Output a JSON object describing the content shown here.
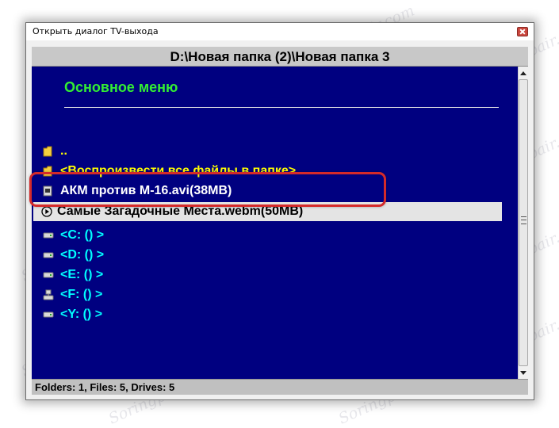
{
  "window": {
    "title": "Открыть диалог TV-выхода"
  },
  "path_bar": {
    "text": "D:\\Новая папка (2)\\Новая папка 3"
  },
  "menu": {
    "main_menu_label": "Основное меню"
  },
  "items": [
    {
      "label": "..",
      "icon": "folder-icon",
      "color": "#ffff00"
    },
    {
      "label": "<Воспроизвести все файлы в папке>",
      "icon": "folder-icon",
      "color": "#ffff00"
    },
    {
      "label": "АКМ против М-16.avi(38MB)",
      "icon": "video-file-icon",
      "color": "#ffffff"
    },
    {
      "label": "Самые Загадочные Места.webm(50MB)",
      "icon": "play-icon",
      "color": "#000000",
      "selected": true
    },
    {
      "label": "<C: () >",
      "icon": "drive-icon",
      "color": "#00ffff"
    },
    {
      "label": "<D: () >",
      "icon": "drive-icon",
      "color": "#00ffff"
    },
    {
      "label": "<E: () >",
      "icon": "drive-icon",
      "color": "#00ffff"
    },
    {
      "label": "<F: () >",
      "icon": "network-drive-icon",
      "color": "#00ffff"
    },
    {
      "label": "<Y: () >",
      "icon": "drive-icon",
      "color": "#00ffff"
    }
  ],
  "status": {
    "text": "Folders: 1, Files: 5, Drives: 5"
  },
  "watermark": {
    "text": "Soringpcrepair.com"
  },
  "colors": {
    "list_background": "#000080",
    "menu_header": "#33ee33",
    "highlight_ring": "#d42a2a"
  }
}
